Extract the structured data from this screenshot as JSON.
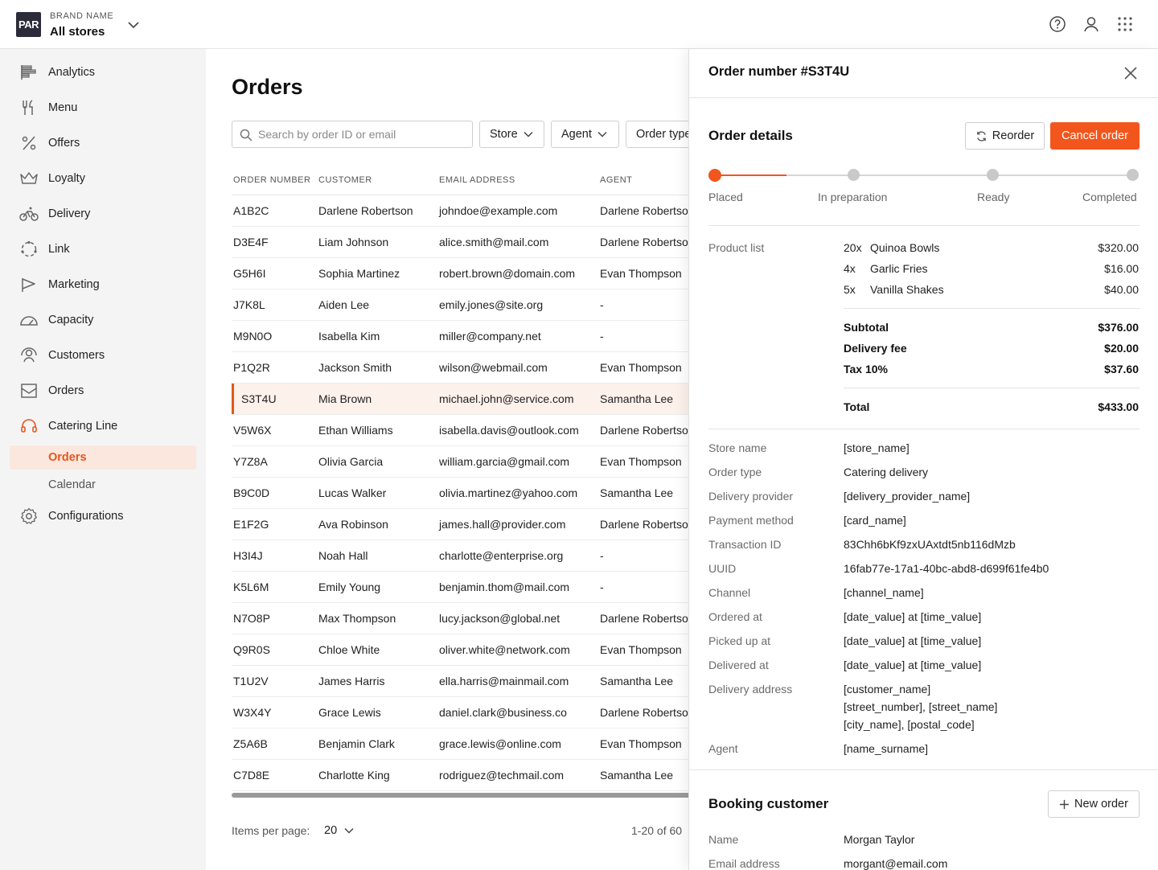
{
  "header": {
    "logo_text": "PAR",
    "brand_label": "BRAND NAME",
    "store_selector": "All stores"
  },
  "sidebar": {
    "items": [
      {
        "label": "Analytics",
        "icon": "analytics-icon"
      },
      {
        "label": "Menu",
        "icon": "fork-knife-icon"
      },
      {
        "label": "Offers",
        "icon": "percent-icon"
      },
      {
        "label": "Loyalty",
        "icon": "crown-icon"
      },
      {
        "label": "Delivery",
        "icon": "bike-icon"
      },
      {
        "label": "Link",
        "icon": "link-circle-icon"
      },
      {
        "label": "Marketing",
        "icon": "flag-icon"
      },
      {
        "label": "Capacity",
        "icon": "gauge-icon"
      },
      {
        "label": "Customers",
        "icon": "customers-icon"
      },
      {
        "label": "Orders",
        "icon": "inbox-icon"
      },
      {
        "label": "Catering Line",
        "icon": "headset-icon"
      }
    ],
    "sub_items": [
      {
        "label": "Orders",
        "active": true
      },
      {
        "label": "Calendar",
        "active": false
      }
    ],
    "config_label": "Configurations"
  },
  "main": {
    "title": "Orders",
    "search_placeholder": "Search by order ID or email",
    "filters": [
      "Store",
      "Agent",
      "Order type"
    ],
    "columns": [
      "ORDER NUMBER",
      "CUSTOMER",
      "EMAIL ADDRESS",
      "AGENT"
    ],
    "rows": [
      [
        "A1B2C",
        "Darlene Robertson",
        "johndoe@example.com",
        "Darlene Robertson"
      ],
      [
        "D3E4F",
        "Liam Johnson",
        "alice.smith@mail.com",
        "Darlene Robertson"
      ],
      [
        "G5H6I",
        "Sophia Martinez",
        "robert.brown@domain.com",
        "Evan Thompson"
      ],
      [
        "J7K8L",
        "Aiden Lee",
        "emily.jones@site.org",
        "-"
      ],
      [
        "M9N0O",
        "Isabella Kim",
        "miller@company.net",
        "-"
      ],
      [
        "P1Q2R",
        "Jackson Smith",
        "wilson@webmail.com",
        "Evan Thompson"
      ],
      [
        "S3T4U",
        "Mia Brown",
        "michael.john@service.com",
        "Samantha Lee"
      ],
      [
        "V5W6X",
        "Ethan Williams",
        "isabella.davis@outlook.com",
        "Darlene Robertson"
      ],
      [
        "Y7Z8A",
        "Olivia Garcia",
        "william.garcia@gmail.com",
        "Evan Thompson"
      ],
      [
        "B9C0D",
        "Lucas Walker",
        "olivia.martinez@yahoo.com",
        "Samantha Lee"
      ],
      [
        "E1F2G",
        "Ava Robinson",
        "james.hall@provider.com",
        "Darlene Robertson"
      ],
      [
        "H3I4J",
        "Noah Hall",
        "charlotte@enterprise.org",
        "-"
      ],
      [
        "K5L6M",
        "Emily Young",
        "benjamin.thom@mail.com",
        "-"
      ],
      [
        "N7O8P",
        "Max Thompson",
        "lucy.jackson@global.net",
        "Darlene Robertson"
      ],
      [
        "Q9R0S",
        "Chloe White",
        "oliver.white@network.com",
        "Evan Thompson"
      ],
      [
        "T1U2V",
        "James Harris",
        "ella.harris@mainmail.com",
        "Samantha Lee"
      ],
      [
        "W3X4Y",
        "Grace Lewis",
        "daniel.clark@business.co",
        "Darlene Robertson"
      ],
      [
        "Z5A6B",
        "Benjamin Clark",
        "grace.lewis@online.com",
        "Evan Thompson"
      ],
      [
        "C7D8E",
        "Charlotte King",
        "rodriguez@techmail.com",
        "Samantha Lee"
      ]
    ],
    "selected_order": "S3T4U",
    "items_per_page_label": "Items per page:",
    "items_per_page_value": "20",
    "range_text": "1-20 of 60"
  },
  "panel": {
    "title": "Order number #S3T4U",
    "details_title": "Order details",
    "reorder_label": "Reorder",
    "cancel_label": "Cancel order",
    "steps": [
      "Placed",
      "In preparation",
      "Ready",
      "Completed"
    ],
    "current_step": 1,
    "product_list_label": "Product list",
    "products": [
      {
        "qty": "20x",
        "name": "Quinoa Bowls",
        "price": "$320.00"
      },
      {
        "qty": "4x",
        "name": "Garlic Fries",
        "price": "$16.00"
      },
      {
        "qty": "5x",
        "name": "Vanilla Shakes",
        "price": "$40.00"
      }
    ],
    "subtotal_label": "Subtotal",
    "subtotal": "$376.00",
    "delivery_fee_label": "Delivery fee",
    "delivery_fee": "$20.00",
    "tax_label": "Tax 10%",
    "tax": "$37.60",
    "total_label": "Total",
    "total": "$433.00",
    "info": [
      {
        "label": "Store name",
        "value": "[store_name]"
      },
      {
        "label": "Order type",
        "value": "Catering delivery"
      },
      {
        "label": "Delivery provider",
        "value": "[delivery_provider_name]"
      },
      {
        "label": "Payment method",
        "value": "[card_name]"
      },
      {
        "label": "Transaction ID",
        "value": "83Chh6bKf9zxUAxtdt5nb116dMzb"
      },
      {
        "label": "UUID",
        "value": "16fab77e-17a1-40bc-abd8-d699f61fe4b0"
      },
      {
        "label": "Channel",
        "value": "[channel_name]"
      },
      {
        "label": "Ordered at",
        "value": "[date_value] at [time_value]"
      },
      {
        "label": "Picked up at",
        "value": "[date_value] at [time_value]"
      },
      {
        "label": "Delivered at",
        "value": "[date_value] at [time_value]"
      }
    ],
    "delivery_address_label": "Delivery address",
    "delivery_address": [
      "[customer_name]",
      "[street_number], [street_name]",
      "[city_name], [postal_code]"
    ],
    "agent_label": "Agent",
    "agent_value": "[name_surname]",
    "booking_title": "Booking customer",
    "new_order_label": "New order",
    "name_label": "Name",
    "name_value": "Morgan Taylor",
    "email_label": "Email address",
    "email_value": "morgant@email.com"
  },
  "colors": {
    "accent": "#f2561d",
    "active_bg": "#fbe7de",
    "sidebar_bg": "#f4f4f4"
  }
}
